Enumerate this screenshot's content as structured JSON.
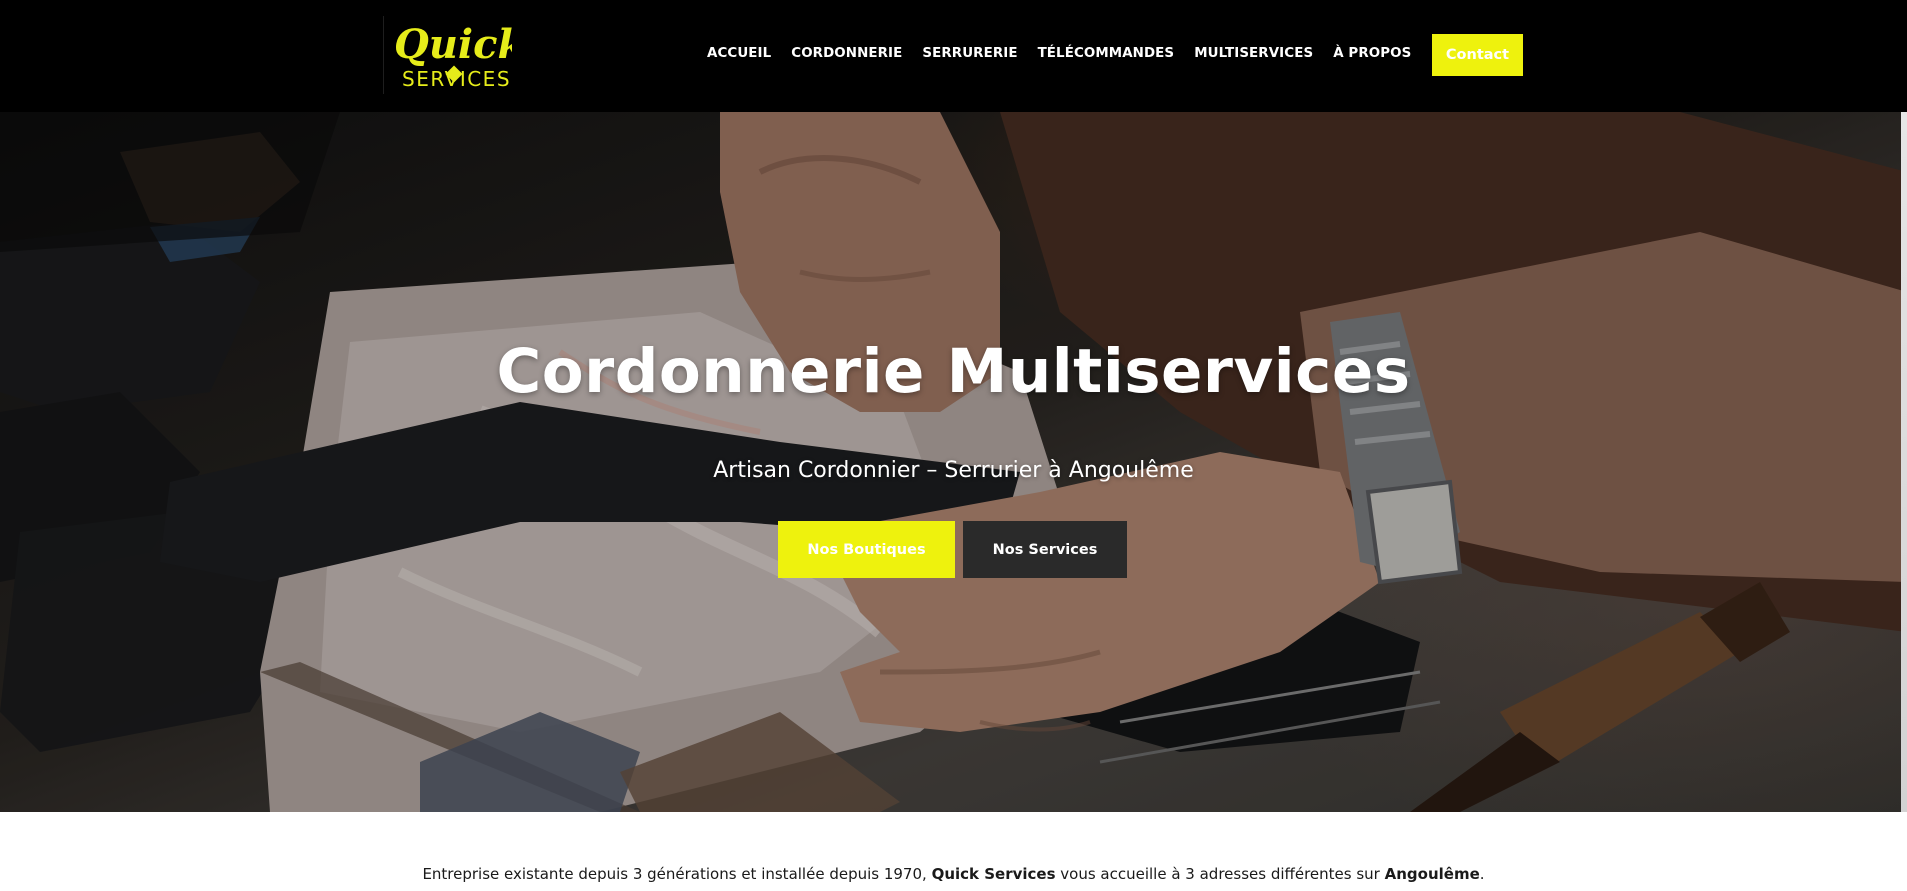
{
  "header": {
    "logo": {
      "word1": "Quick",
      "word2": "SERVICES"
    },
    "nav": [
      {
        "label": "ACCUEIL"
      },
      {
        "label": "CORDONNERIE"
      },
      {
        "label": "SERRURERIE"
      },
      {
        "label": "TÉLÉCOMMANDES"
      },
      {
        "label": "MULTISERVICES"
      },
      {
        "label": "À PROPOS"
      }
    ],
    "search_icon": "search-icon",
    "contact_label": "Contact"
  },
  "hero": {
    "title": "Cordonnerie Multiservices",
    "subtitle": "Artisan Cordonnier – Serrurier à Angoulême",
    "primary_button": "Nos Boutiques",
    "secondary_button": "Nos Services"
  },
  "intro": {
    "part1": "Entreprise existante depuis 3 générations et installée depuis 1970, ",
    "brand": "Quick Services",
    "part2": " vous accueille à 3 adresses différentes sur ",
    "city": "Angoulême",
    "part3": "."
  },
  "colors": {
    "accent": "#eef20d",
    "header_bg": "#000000",
    "dark_button": "#2a2a2a",
    "text_dark": "#1a1a1a"
  }
}
